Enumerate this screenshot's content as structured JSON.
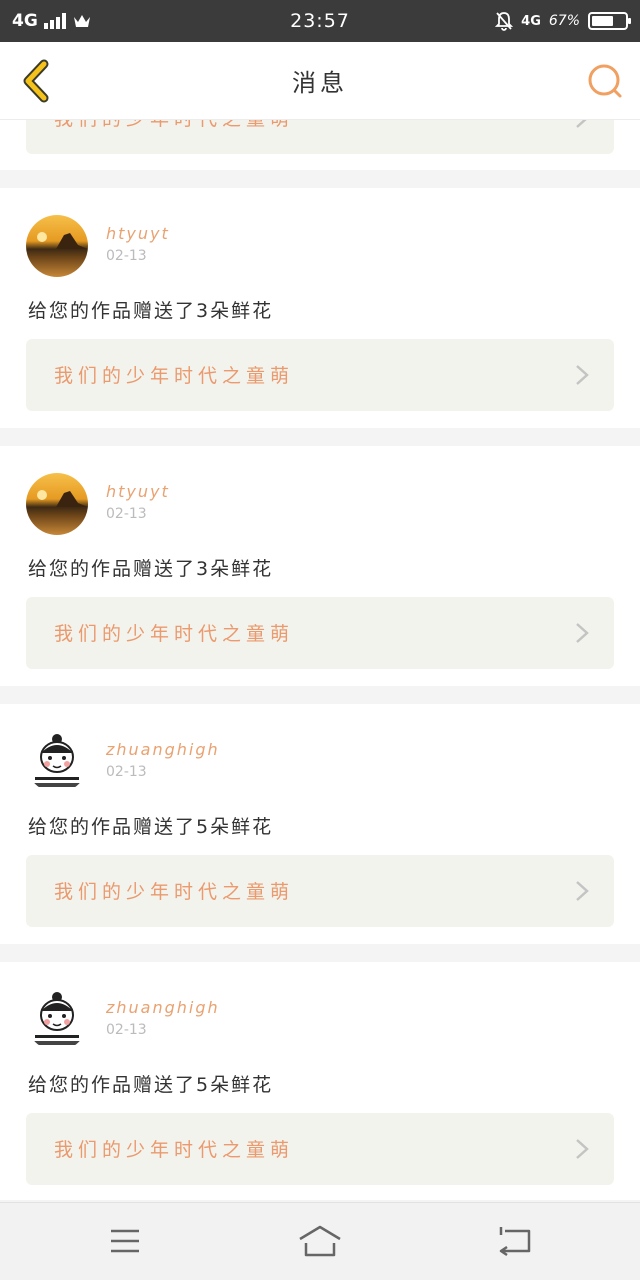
{
  "status_bar": {
    "network": "4G",
    "time": "23:57",
    "network_right": "4G",
    "battery": "67%",
    "battery_level": 0.67
  },
  "header": {
    "title": "消息"
  },
  "items": [
    {
      "work_title": "我们的少年时代之童萌"
    },
    {
      "username": "htyuyt",
      "date": "02-13",
      "message": "给您的作品赠送了3朵鲜花",
      "work_title": "我们的少年时代之童萌"
    },
    {
      "username": "htyuyt",
      "date": "02-13",
      "message": "给您的作品赠送了3朵鲜花",
      "work_title": "我们的少年时代之童萌"
    },
    {
      "username": "zhuanghigh",
      "date": "02-13",
      "message": "给您的作品赠送了5朵鲜花",
      "work_title": "我们的少年时代之童萌"
    },
    {
      "username": "zhuanghigh",
      "date": "02-13",
      "message": "给您的作品赠送了5朵鲜花",
      "work_title": "我们的少年时代之童萌"
    }
  ],
  "colors": {
    "accent": "#ea9a6d",
    "back_arrow": "#f5c21b"
  }
}
